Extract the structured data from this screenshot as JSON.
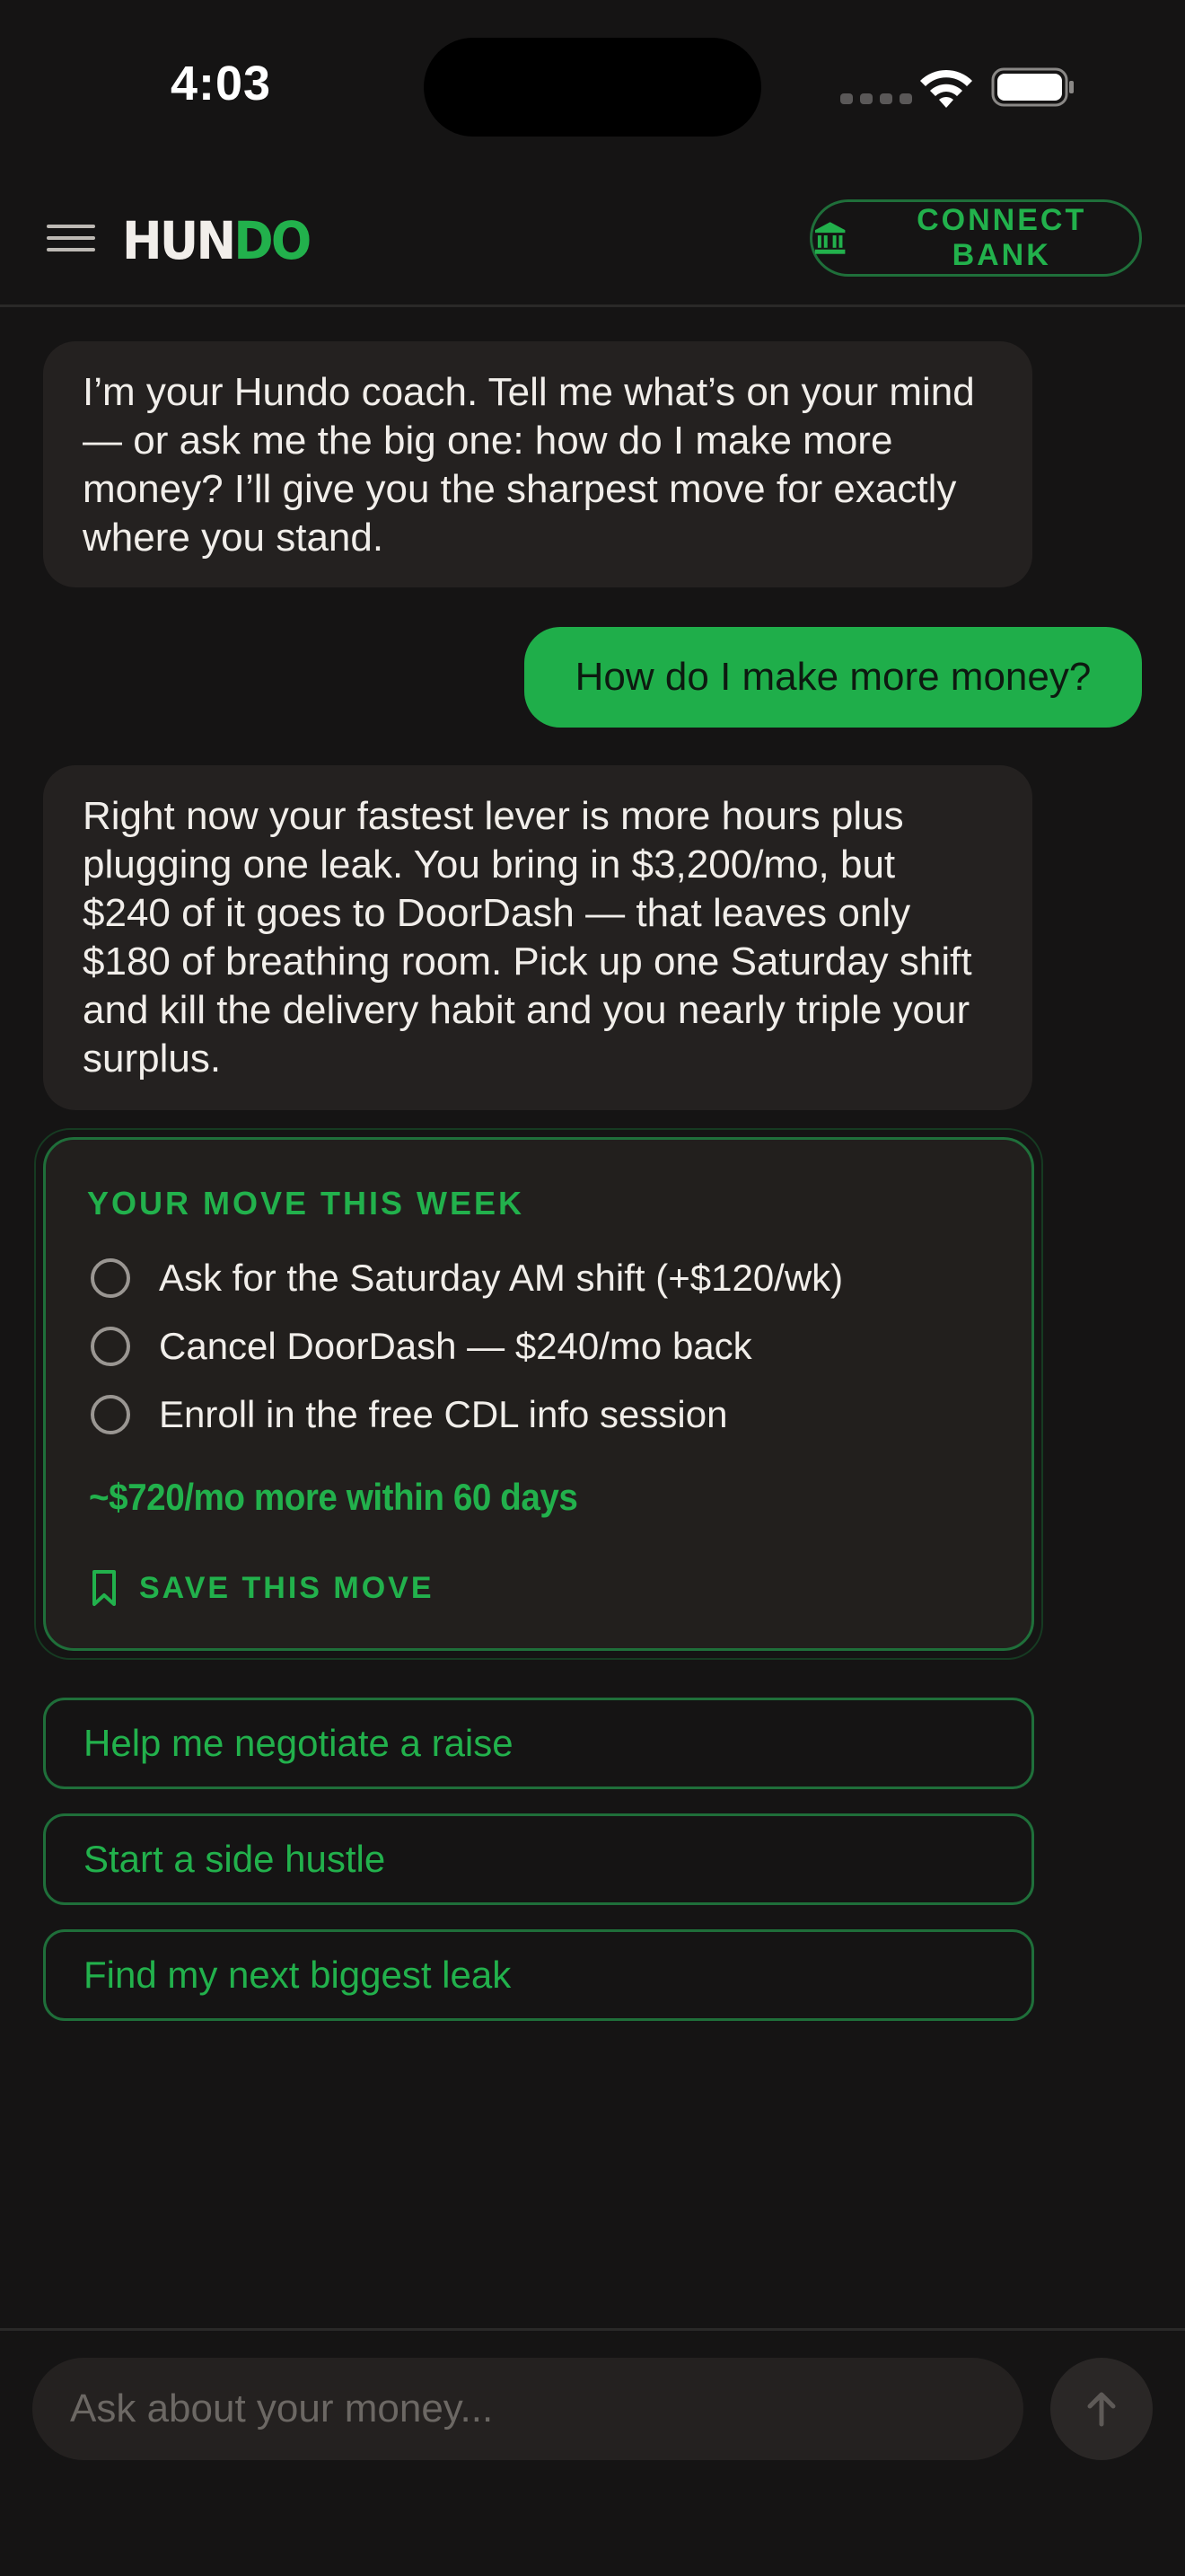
{
  "status_bar": {
    "time": "4:03"
  },
  "header": {
    "logo_part1": "HUN",
    "logo_part2": "DO",
    "connect_bank_label": "CONNECT BANK"
  },
  "messages": {
    "coach_intro": "I’m your Hundo coach. Tell me what’s on your mind — or ask me the big one: how do I make more money? I’ll give you the sharpest move for exactly where you stand.",
    "user_question": "How do I make more money?",
    "coach_reply": "Right now your fastest lever is more hours plus plugging one leak. You bring in $3,200/mo, but $240 of it goes to DoorDash — that leaves only $180 of breathing room. Pick up one Saturday shift and kill the delivery habit and you nearly triple your surplus."
  },
  "move_card": {
    "title": "YOUR MOVE THIS WEEK",
    "tasks": [
      {
        "label": "Ask for the Saturday AM shift (+$120/wk)",
        "checked": false
      },
      {
        "label": "Cancel DoorDash — $240/mo back",
        "checked": false
      },
      {
        "label": "Enroll in the free CDL info session",
        "checked": false
      }
    ],
    "summary": "~$720/mo more within 60 days",
    "save_label": "SAVE THIS MOVE"
  },
  "suggestions": [
    "Help me negotiate a raise",
    "Start a side hustle",
    "Find my next biggest leak"
  ],
  "composer": {
    "placeholder": "Ask about your money..."
  },
  "colors": {
    "background": "#151414",
    "bubble": "#242120",
    "accent_green": "#22b14c",
    "user_bubble": "#1fae4a",
    "border_green": "#1f6f3a"
  },
  "icons": [
    "menu-icon",
    "bank-icon",
    "bookmark-icon",
    "arrow-up-icon",
    "wifi-icon",
    "battery-icon"
  ]
}
